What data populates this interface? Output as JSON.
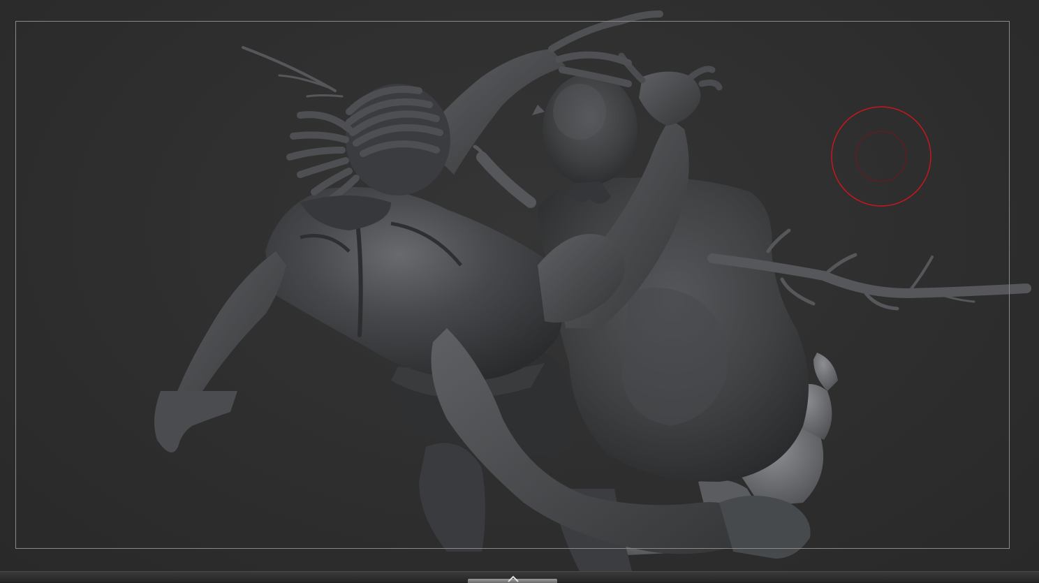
{
  "viewport": {
    "background_color": "#2e2e2e",
    "frame_color": "#8a8a8a",
    "model_color": "#3f4042",
    "model_highlight": "#6c6e72",
    "model_shadow": "#232426"
  },
  "brush": {
    "outer_ring_color": "#c8161e",
    "inner_ring_color": "#7a1418"
  },
  "bottom_bar": {
    "handle_icon": "chevron-up-icon"
  }
}
